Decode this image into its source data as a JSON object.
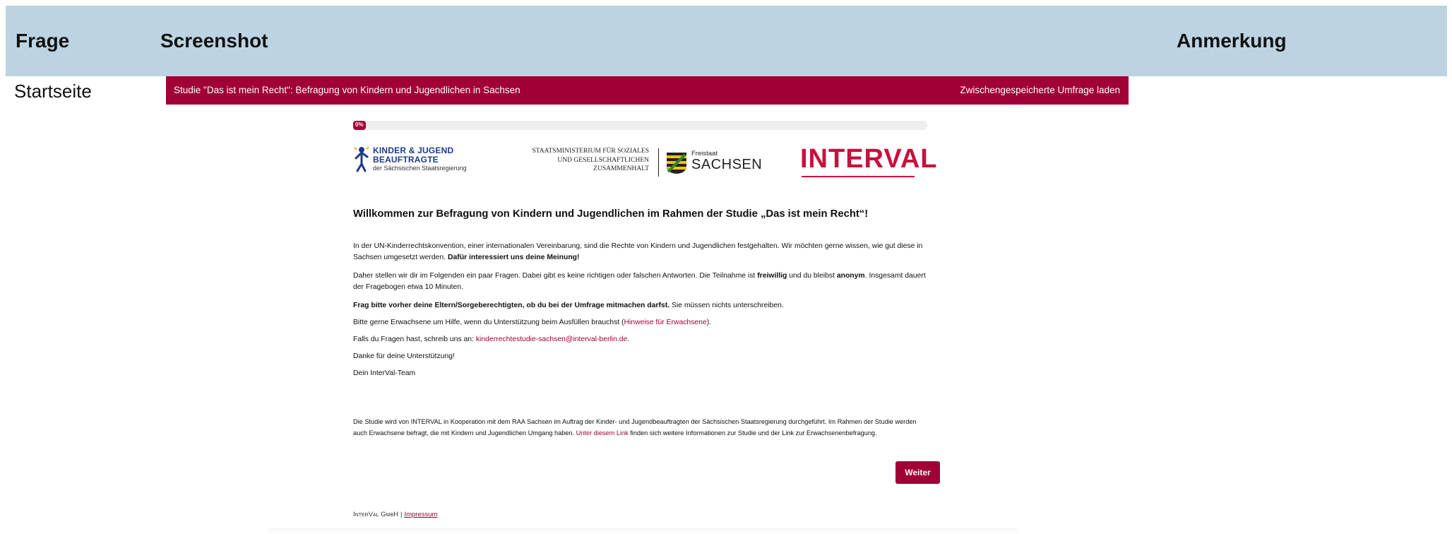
{
  "table_header": {
    "col_frage": "Frage",
    "col_screenshot": "Screenshot",
    "col_anmerkung": "Anmerkung"
  },
  "row": {
    "label": "Startseite"
  },
  "survey": {
    "topbar": {
      "title": "Studie \"Das ist mein Recht\": Befragung von Kindern und Jugendlichen in Sachsen",
      "load_link": "Zwischengespeicherte Umfrage laden"
    },
    "progress": {
      "value": 0,
      "label": "0%"
    },
    "logos": {
      "kjb": {
        "line1": "KINDER & JUGEND",
        "line2": "BEAUFTRAGTE",
        "line3": "der Sächsischen Staatsregierung"
      },
      "sms": {
        "line1": "STAATSMINISTERIUM FÜR SOZIALES",
        "line2": "UND GESELLSCHAFTLICHEN",
        "line3": "ZUSAMMENHALT",
        "land_small": "Freistaat",
        "land_big": "SACHSEN"
      },
      "interval": {
        "text": "INTERVAL"
      }
    },
    "title": "Willkommen zur Befragung von Kindern und Jugendlichen im Rahmen der Studie „Das ist mein Recht“!",
    "paragraphs": {
      "p1_text": "In der UN-Kinderrechtskonvention, einer internationalen Vereinbarung, sind die Rechte von Kindern und Jugendlichen festgehalten. Wir möchten gerne wissen, wie gut diese in Sachsen umgesetzt werden. ",
      "p1_bold": "Dafür interessiert uns deine Meinung!",
      "p2_a": "Daher stellen wir dir im Folgenden ein paar Fragen. Dabei gibt es keine richtigen oder falschen Antworten. Die Teilnahme ist ",
      "p2_bold1": "freiwillig",
      "p2_b": " und du bleibst ",
      "p2_bold2": "anonym",
      "p2_c": ". Insgesamt dauert der Fragebogen etwa 10 Minuten.",
      "p3_bold": "Frag bitte vorher deine Eltern/Sorgeberechtigten, ob du bei der Umfrage mitmachen darfst.",
      "p3_text": " Sie müssen nichts unterschreiben.",
      "p4_a": "Bitte gerne Erwachsene um Hilfe, wenn du Unterstützung beim Ausfüllen brauchst (",
      "p4_link": "Hinweise für Erwachsene",
      "p4_b": ").",
      "p5_a": "Falls du Fragen hast, schreib uns an: ",
      "p5_link": "kinderrechtestudie-sachsen@interval-berlin.de",
      "p5_b": ".",
      "p6": "Danke für deine Unterstützung!",
      "p7": "Dein InterVal-Team"
    },
    "footnote": {
      "a": "Die Studie wird von INTERVAL in Kooperation mit dem RAA Sachsen im Auftrag der Kinder- und Jugendbeauftragten der Sächsischen Staatsregierung durchgeführt. Im Rahmen der Studie werden auch Erwachsene befragt, die mit Kindern und Jugendlichen Umgang haben. ",
      "link": "Unter diesem Link",
      "b": " finden sich weitere Informationen zur Studie und der Link zur Erwachsenenbefragung."
    },
    "next_button": "Weiter",
    "footer": {
      "company": "InterVal GmbH",
      "separator": "|",
      "imprint": "Impressum"
    },
    "colors": {
      "brand": "#a00036",
      "header_bg": "#bcd3e2",
      "interval_red": "#c8103d"
    }
  }
}
